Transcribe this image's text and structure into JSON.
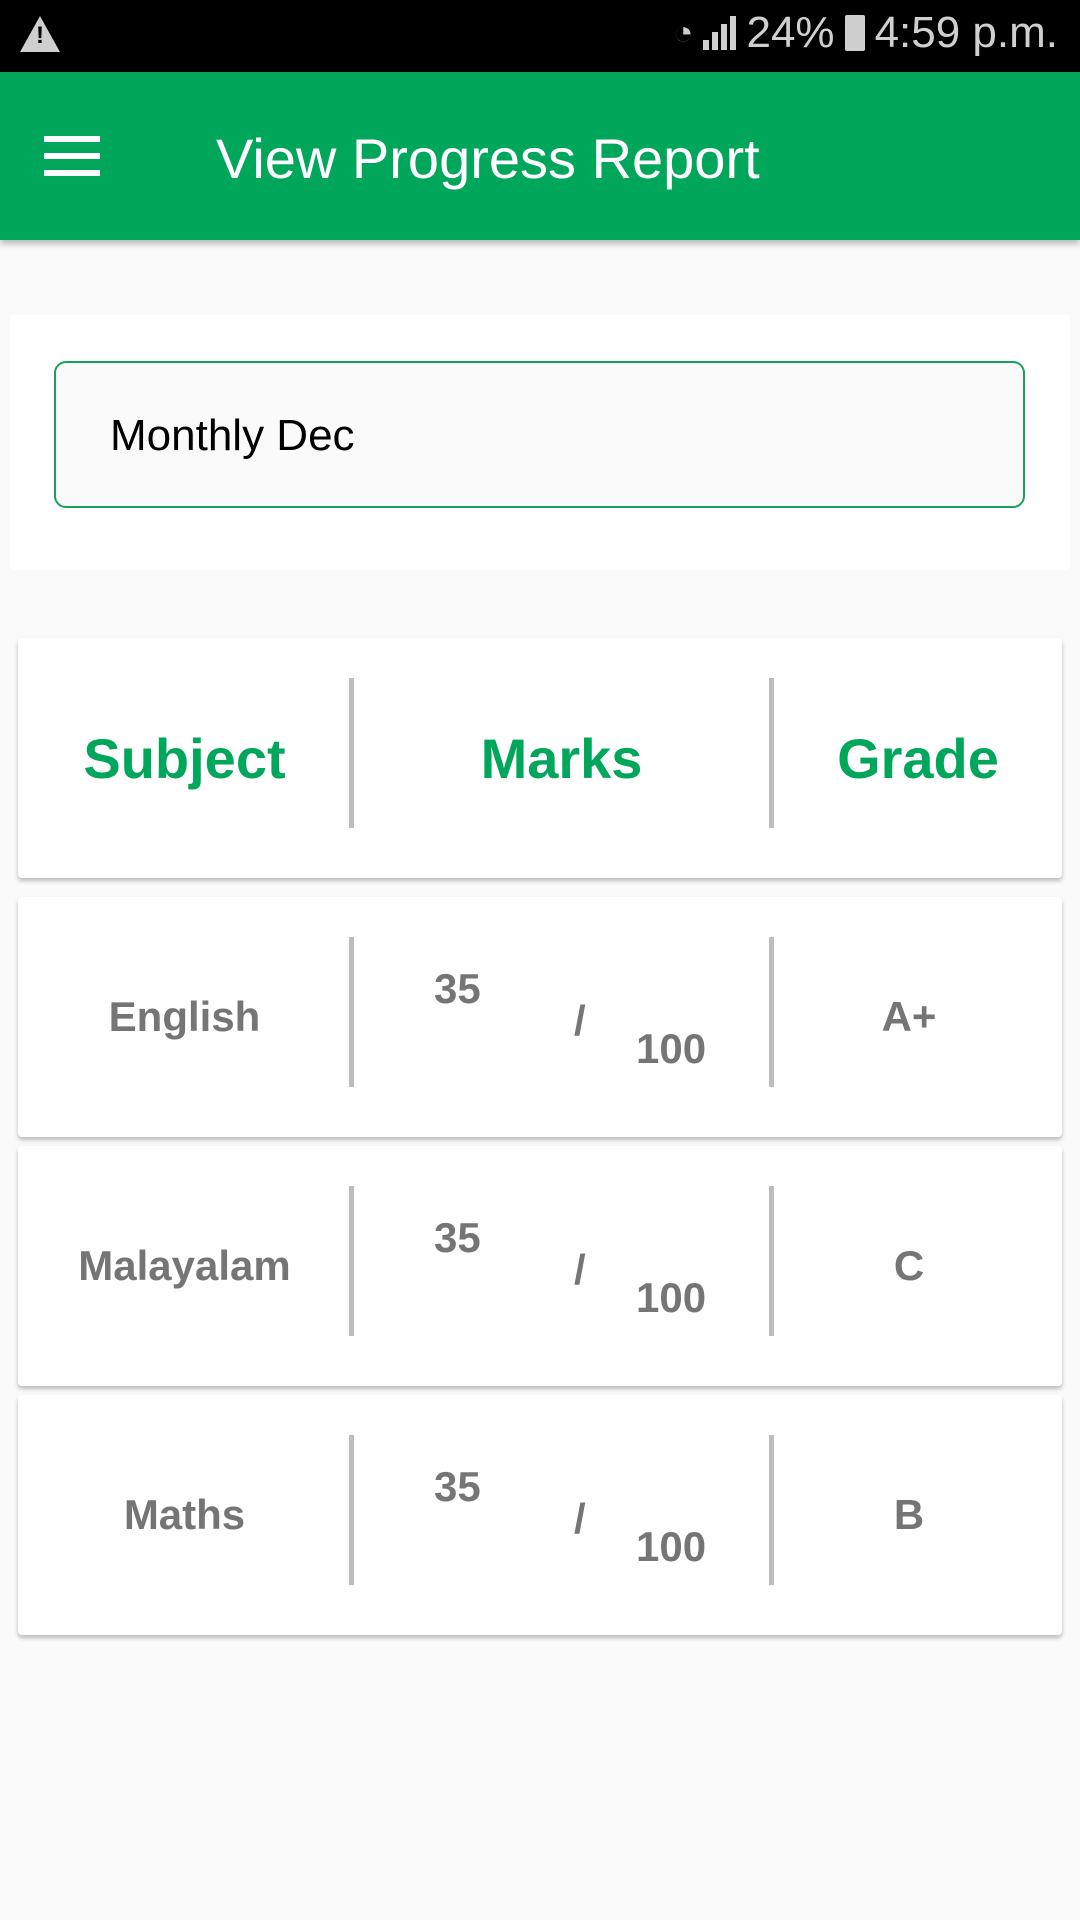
{
  "status_bar": {
    "battery": "24%",
    "time": "4:59 p.m.",
    "icons": [
      "warning-icon",
      "wifi-icon",
      "signal-icon",
      "battery-charging-icon"
    ]
  },
  "app_bar": {
    "title": "View Progress Report",
    "menu_icon": "hamburger-menu-icon"
  },
  "exam_selector": {
    "value": "Monthly Dec"
  },
  "table": {
    "headers": [
      "Subject",
      "Marks",
      "Grade"
    ],
    "rows": [
      {
        "subject": "English",
        "marks": "35",
        "separator": "/",
        "total": "100",
        "grade": "A+"
      },
      {
        "subject": "Malayalam",
        "marks": "35",
        "separator": "/",
        "total": "100",
        "grade": "C"
      },
      {
        "subject": "Maths",
        "marks": "35",
        "separator": "/",
        "total": "100",
        "grade": "B"
      }
    ]
  },
  "colors": {
    "primary": "#00a65a",
    "text_gray": "#757575"
  }
}
